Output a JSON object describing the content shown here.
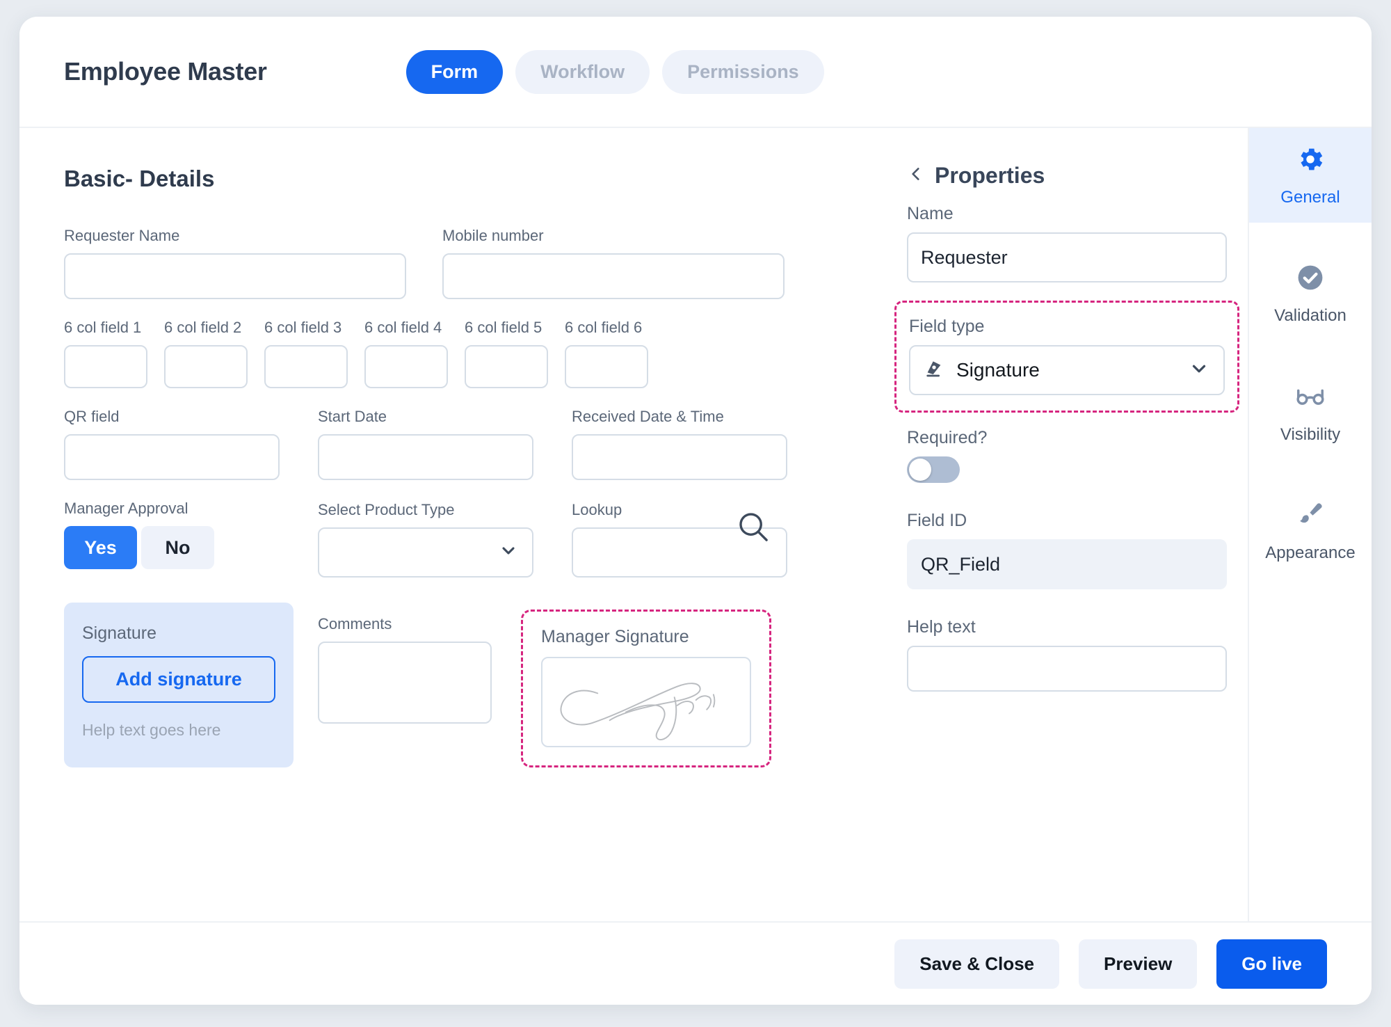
{
  "header": {
    "title": "Employee Master",
    "tabs": [
      {
        "label": "Form",
        "active": true
      },
      {
        "label": "Workflow",
        "active": false
      },
      {
        "label": "Permissions",
        "active": false
      }
    ]
  },
  "canvas": {
    "section_title": "Basic- Details",
    "row_two": [
      {
        "label": "Requester Name",
        "value": ""
      },
      {
        "label": "Mobile number",
        "value": ""
      }
    ],
    "six_cols": [
      {
        "label": "6 col field 1",
        "value": ""
      },
      {
        "label": "6 col field 2",
        "value": ""
      },
      {
        "label": "6 col field 3",
        "value": ""
      },
      {
        "label": "6 col field 4",
        "value": ""
      },
      {
        "label": "6 col field 5",
        "value": ""
      },
      {
        "label": "6 col field 6",
        "value": ""
      }
    ],
    "row_three": [
      {
        "label": "QR field",
        "value": ""
      },
      {
        "label": "Start Date",
        "value": ""
      },
      {
        "label": "Received Date & Time",
        "value": ""
      }
    ],
    "manager_approval": {
      "label": "Manager Approval",
      "options": [
        {
          "label": "Yes",
          "selected": true
        },
        {
          "label": "No",
          "selected": false
        }
      ]
    },
    "product_type": {
      "label": "Select Product Type",
      "value": ""
    },
    "lookup": {
      "label": "Lookup",
      "value": ""
    },
    "signature_card": {
      "label": "Signature",
      "button_label": "Add signature",
      "help_text": "Help text goes here"
    },
    "comments": {
      "label": "Comments",
      "value": ""
    },
    "manager_signature": {
      "label": "Manager Signature",
      "value": ""
    }
  },
  "properties": {
    "title": "Properties",
    "name": {
      "label": "Name",
      "value": "Requester",
      "placeholder": ""
    },
    "field_type": {
      "label": "Field type",
      "value": "Signature"
    },
    "required": {
      "label": "Required?",
      "on": false
    },
    "field_id": {
      "label": "Field ID",
      "value": "QR_Field"
    },
    "help_text": {
      "label": "Help text",
      "value": "",
      "placeholder": ""
    }
  },
  "rail": [
    {
      "label": "General",
      "icon": "gear-icon",
      "active": true
    },
    {
      "label": "Validation",
      "icon": "check-circle-icon",
      "active": false
    },
    {
      "label": "Visibility",
      "icon": "glasses-icon",
      "active": false
    },
    {
      "label": "Appearance",
      "icon": "brush-icon",
      "active": false
    }
  ],
  "footer": {
    "save_close_label": "Save  & Close",
    "preview_label": "Preview",
    "go_live_label": "Go live"
  },
  "colors": {
    "accent_blue": "#1668f0",
    "highlight_pink": "#d6257f",
    "panel_bg": "#dde8fb"
  }
}
